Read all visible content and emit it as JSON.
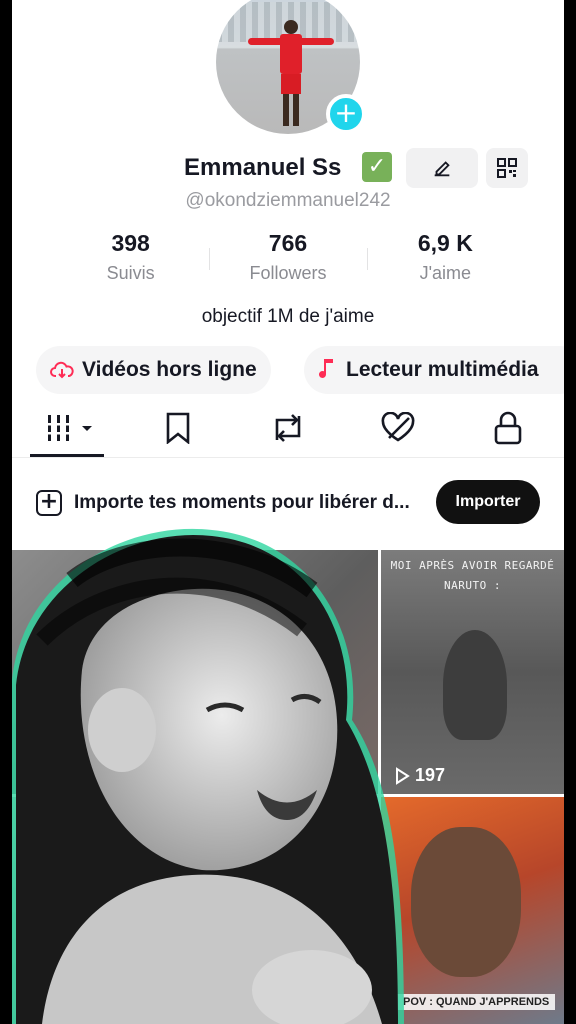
{
  "profile": {
    "display_name": "Emmanuel Ss",
    "verified_emoji": "✓",
    "handle": "@okondziemmanuel242",
    "bio": "objectif 1M de j'aime",
    "avatar_plus": "+"
  },
  "stats": [
    {
      "value": "398",
      "label": "Suivis"
    },
    {
      "value": "766",
      "label": "Followers"
    },
    {
      "value": "6,9 K",
      "label": "J'aime"
    }
  ],
  "pills": {
    "offline": "Vidéos hors ligne",
    "player": "Lecteur multimédia"
  },
  "tabs": [
    "videos-grid",
    "saved",
    "reposts",
    "liked",
    "private"
  ],
  "import_banner": {
    "text": "Importe tes moments pour libérer d...",
    "button": "Importer"
  },
  "videos": [
    {
      "caption": ""
    },
    {
      "caption": "MOI APRÈS AVOIR REGARDÉ NARUTO :",
      "views": "197"
    },
    {
      "caption": ""
    },
    {
      "caption": "POV : QUAND J'APPRENDS"
    }
  ],
  "colors": {
    "accent_cyan": "#20d5ec",
    "brand_red": "#fe2c55",
    "verified_green": "#78b159",
    "text_primary": "#161823",
    "text_secondary": "#8a8b91"
  }
}
